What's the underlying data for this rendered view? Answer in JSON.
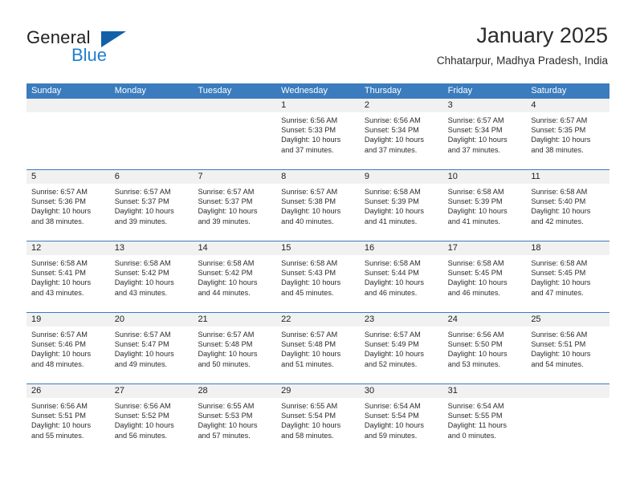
{
  "logo": {
    "word_top": "General",
    "word_bottom": "Blue",
    "triangle_color": "#1261a8",
    "blue_color": "#1f7fd0"
  },
  "header": {
    "title": "January 2025",
    "subtitle": "Chhatarpur, Madhya Pradesh, India"
  },
  "colors": {
    "header_row": "#3a7cbe",
    "daynum_band": "#f1f1f1",
    "text": "#2b2b2b"
  },
  "weekday_headers": [
    "Sunday",
    "Monday",
    "Tuesday",
    "Wednesday",
    "Thursday",
    "Friday",
    "Saturday"
  ],
  "weeks": [
    [
      {
        "day": "",
        "empty": true,
        "sunrise": "",
        "sunset": "",
        "daylight_line1": "",
        "daylight_line2": ""
      },
      {
        "day": "",
        "empty": true,
        "sunrise": "",
        "sunset": "",
        "daylight_line1": "",
        "daylight_line2": ""
      },
      {
        "day": "",
        "empty": true,
        "sunrise": "",
        "sunset": "",
        "daylight_line1": "",
        "daylight_line2": ""
      },
      {
        "day": "1",
        "empty": false,
        "sunrise": "Sunrise: 6:56 AM",
        "sunset": "Sunset: 5:33 PM",
        "daylight_line1": "Daylight: 10 hours",
        "daylight_line2": "and 37 minutes."
      },
      {
        "day": "2",
        "empty": false,
        "sunrise": "Sunrise: 6:56 AM",
        "sunset": "Sunset: 5:34 PM",
        "daylight_line1": "Daylight: 10 hours",
        "daylight_line2": "and 37 minutes."
      },
      {
        "day": "3",
        "empty": false,
        "sunrise": "Sunrise: 6:57 AM",
        "sunset": "Sunset: 5:34 PM",
        "daylight_line1": "Daylight: 10 hours",
        "daylight_line2": "and 37 minutes."
      },
      {
        "day": "4",
        "empty": false,
        "sunrise": "Sunrise: 6:57 AM",
        "sunset": "Sunset: 5:35 PM",
        "daylight_line1": "Daylight: 10 hours",
        "daylight_line2": "and 38 minutes."
      }
    ],
    [
      {
        "day": "5",
        "empty": false,
        "sunrise": "Sunrise: 6:57 AM",
        "sunset": "Sunset: 5:36 PM",
        "daylight_line1": "Daylight: 10 hours",
        "daylight_line2": "and 38 minutes."
      },
      {
        "day": "6",
        "empty": false,
        "sunrise": "Sunrise: 6:57 AM",
        "sunset": "Sunset: 5:37 PM",
        "daylight_line1": "Daylight: 10 hours",
        "daylight_line2": "and 39 minutes."
      },
      {
        "day": "7",
        "empty": false,
        "sunrise": "Sunrise: 6:57 AM",
        "sunset": "Sunset: 5:37 PM",
        "daylight_line1": "Daylight: 10 hours",
        "daylight_line2": "and 39 minutes."
      },
      {
        "day": "8",
        "empty": false,
        "sunrise": "Sunrise: 6:57 AM",
        "sunset": "Sunset: 5:38 PM",
        "daylight_line1": "Daylight: 10 hours",
        "daylight_line2": "and 40 minutes."
      },
      {
        "day": "9",
        "empty": false,
        "sunrise": "Sunrise: 6:58 AM",
        "sunset": "Sunset: 5:39 PM",
        "daylight_line1": "Daylight: 10 hours",
        "daylight_line2": "and 41 minutes."
      },
      {
        "day": "10",
        "empty": false,
        "sunrise": "Sunrise: 6:58 AM",
        "sunset": "Sunset: 5:39 PM",
        "daylight_line1": "Daylight: 10 hours",
        "daylight_line2": "and 41 minutes."
      },
      {
        "day": "11",
        "empty": false,
        "sunrise": "Sunrise: 6:58 AM",
        "sunset": "Sunset: 5:40 PM",
        "daylight_line1": "Daylight: 10 hours",
        "daylight_line2": "and 42 minutes."
      }
    ],
    [
      {
        "day": "12",
        "empty": false,
        "sunrise": "Sunrise: 6:58 AM",
        "sunset": "Sunset: 5:41 PM",
        "daylight_line1": "Daylight: 10 hours",
        "daylight_line2": "and 43 minutes."
      },
      {
        "day": "13",
        "empty": false,
        "sunrise": "Sunrise: 6:58 AM",
        "sunset": "Sunset: 5:42 PM",
        "daylight_line1": "Daylight: 10 hours",
        "daylight_line2": "and 43 minutes."
      },
      {
        "day": "14",
        "empty": false,
        "sunrise": "Sunrise: 6:58 AM",
        "sunset": "Sunset: 5:42 PM",
        "daylight_line1": "Daylight: 10 hours",
        "daylight_line2": "and 44 minutes."
      },
      {
        "day": "15",
        "empty": false,
        "sunrise": "Sunrise: 6:58 AM",
        "sunset": "Sunset: 5:43 PM",
        "daylight_line1": "Daylight: 10 hours",
        "daylight_line2": "and 45 minutes."
      },
      {
        "day": "16",
        "empty": false,
        "sunrise": "Sunrise: 6:58 AM",
        "sunset": "Sunset: 5:44 PM",
        "daylight_line1": "Daylight: 10 hours",
        "daylight_line2": "and 46 minutes."
      },
      {
        "day": "17",
        "empty": false,
        "sunrise": "Sunrise: 6:58 AM",
        "sunset": "Sunset: 5:45 PM",
        "daylight_line1": "Daylight: 10 hours",
        "daylight_line2": "and 46 minutes."
      },
      {
        "day": "18",
        "empty": false,
        "sunrise": "Sunrise: 6:58 AM",
        "sunset": "Sunset: 5:45 PM",
        "daylight_line1": "Daylight: 10 hours",
        "daylight_line2": "and 47 minutes."
      }
    ],
    [
      {
        "day": "19",
        "empty": false,
        "sunrise": "Sunrise: 6:57 AM",
        "sunset": "Sunset: 5:46 PM",
        "daylight_line1": "Daylight: 10 hours",
        "daylight_line2": "and 48 minutes."
      },
      {
        "day": "20",
        "empty": false,
        "sunrise": "Sunrise: 6:57 AM",
        "sunset": "Sunset: 5:47 PM",
        "daylight_line1": "Daylight: 10 hours",
        "daylight_line2": "and 49 minutes."
      },
      {
        "day": "21",
        "empty": false,
        "sunrise": "Sunrise: 6:57 AM",
        "sunset": "Sunset: 5:48 PM",
        "daylight_line1": "Daylight: 10 hours",
        "daylight_line2": "and 50 minutes."
      },
      {
        "day": "22",
        "empty": false,
        "sunrise": "Sunrise: 6:57 AM",
        "sunset": "Sunset: 5:48 PM",
        "daylight_line1": "Daylight: 10 hours",
        "daylight_line2": "and 51 minutes."
      },
      {
        "day": "23",
        "empty": false,
        "sunrise": "Sunrise: 6:57 AM",
        "sunset": "Sunset: 5:49 PM",
        "daylight_line1": "Daylight: 10 hours",
        "daylight_line2": "and 52 minutes."
      },
      {
        "day": "24",
        "empty": false,
        "sunrise": "Sunrise: 6:56 AM",
        "sunset": "Sunset: 5:50 PM",
        "daylight_line1": "Daylight: 10 hours",
        "daylight_line2": "and 53 minutes."
      },
      {
        "day": "25",
        "empty": false,
        "sunrise": "Sunrise: 6:56 AM",
        "sunset": "Sunset: 5:51 PM",
        "daylight_line1": "Daylight: 10 hours",
        "daylight_line2": "and 54 minutes."
      }
    ],
    [
      {
        "day": "26",
        "empty": false,
        "sunrise": "Sunrise: 6:56 AM",
        "sunset": "Sunset: 5:51 PM",
        "daylight_line1": "Daylight: 10 hours",
        "daylight_line2": "and 55 minutes."
      },
      {
        "day": "27",
        "empty": false,
        "sunrise": "Sunrise: 6:56 AM",
        "sunset": "Sunset: 5:52 PM",
        "daylight_line1": "Daylight: 10 hours",
        "daylight_line2": "and 56 minutes."
      },
      {
        "day": "28",
        "empty": false,
        "sunrise": "Sunrise: 6:55 AM",
        "sunset": "Sunset: 5:53 PM",
        "daylight_line1": "Daylight: 10 hours",
        "daylight_line2": "and 57 minutes."
      },
      {
        "day": "29",
        "empty": false,
        "sunrise": "Sunrise: 6:55 AM",
        "sunset": "Sunset: 5:54 PM",
        "daylight_line1": "Daylight: 10 hours",
        "daylight_line2": "and 58 minutes."
      },
      {
        "day": "30",
        "empty": false,
        "sunrise": "Sunrise: 6:54 AM",
        "sunset": "Sunset: 5:54 PM",
        "daylight_line1": "Daylight: 10 hours",
        "daylight_line2": "and 59 minutes."
      },
      {
        "day": "31",
        "empty": false,
        "sunrise": "Sunrise: 6:54 AM",
        "sunset": "Sunset: 5:55 PM",
        "daylight_line1": "Daylight: 11 hours",
        "daylight_line2": "and 0 minutes."
      },
      {
        "day": "",
        "empty": true,
        "sunrise": "",
        "sunset": "",
        "daylight_line1": "",
        "daylight_line2": ""
      }
    ]
  ]
}
